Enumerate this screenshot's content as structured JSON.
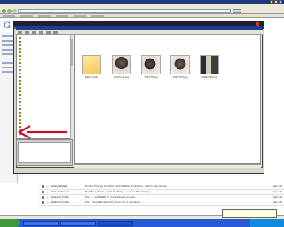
{
  "inbox": {
    "rows": [
      {
        "from": "babysitalea",
        "subject": "Home Energy Monitor, Solo Water Collector, Catch Say Guide",
        "date": "Apr 20"
      },
      {
        "from": "Tim Anderson",
        "subject": "Bad Dog Bowl, Cold Air Entry - Look ! Mandalogo",
        "date": "Apr 20"
      },
      {
        "from": "Gabriel Cofre",
        "subject": "Fw: ~~GABRIEL !! necesito se enviar..",
        "date": "Apr 20"
      },
      {
        "from": "Gabriel Cofre",
        "subject": "Fw: - Sexy Briefmaria, Una ido a diedsola..",
        "date": "Apr 20"
      }
    ]
  },
  "dialog": {
    "thumbnails": [
      {
        "caption": "New Folder"
      },
      {
        "caption": "GCThin4.jpg"
      },
      {
        "caption": "TRD7TH.jpg"
      },
      {
        "caption": "TRD7TH4.jpg"
      },
      {
        "caption": "DSN0038.jpg"
      }
    ]
  },
  "colors": {
    "taskbar": "#2a5bd7",
    "start": "#3c9a3c",
    "dialog_title": "#1b3f8f",
    "annotation_arrow": "#c8102e"
  }
}
